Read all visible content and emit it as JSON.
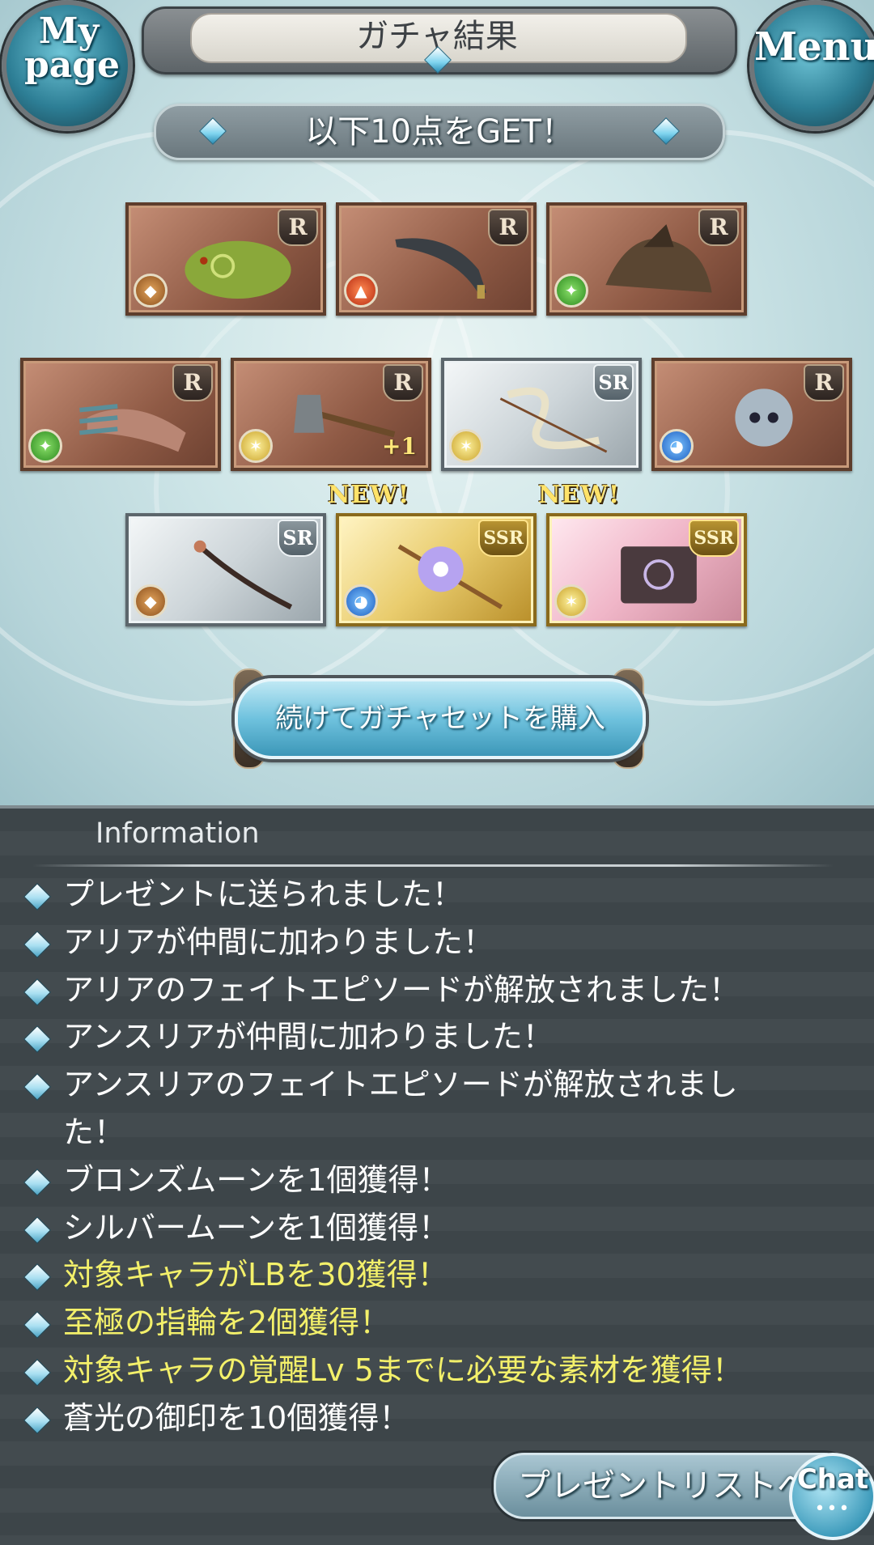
{
  "header": {
    "title": "ガチャ結果",
    "mypage_label_line1": "My",
    "mypage_label_line2": "page",
    "menu_label": "Menu"
  },
  "result_banner": "以下10点をGET！",
  "items": [
    {
      "rarity": "R",
      "element": "earth",
      "art": "green-frog-creature",
      "plus": "",
      "new": ""
    },
    {
      "rarity": "R",
      "element": "fire",
      "art": "scimitar",
      "plus": "",
      "new": ""
    },
    {
      "rarity": "R",
      "element": "wind",
      "art": "griffin-beast",
      "plus": "",
      "new": ""
    },
    {
      "rarity": "R",
      "element": "wind",
      "art": "claw-gauntlet",
      "plus": "",
      "new": ""
    },
    {
      "rarity": "R",
      "element": "light",
      "art": "battle-axe",
      "plus": "+1",
      "new": ""
    },
    {
      "rarity": "SR",
      "element": "light",
      "art": "ribbon-staff",
      "plus": "",
      "new": ""
    },
    {
      "rarity": "R",
      "element": "water",
      "art": "armored-skeleton",
      "plus": "",
      "new": ""
    },
    {
      "rarity": "SR",
      "element": "earth",
      "art": "long-bow",
      "plus": "",
      "new": ""
    },
    {
      "rarity": "SSR",
      "element": "water",
      "art": "flower-staff",
      "plus": "",
      "new": "NEW!"
    },
    {
      "rarity": "SSR",
      "element": "light",
      "art": "grimoire-book",
      "plus": "",
      "new": "NEW!"
    }
  ],
  "buy_button": "続けてガチャセットを購入",
  "information": {
    "title": "Information",
    "messages": [
      {
        "text": "プレゼントに送られました！",
        "highlight": false
      },
      {
        "text": "アリアが仲間に加わりました！",
        "highlight": false
      },
      {
        "text": "アリアのフェイトエピソードが解放されました！",
        "highlight": false
      },
      {
        "text": "アンスリアが仲間に加わりました！",
        "highlight": false
      },
      {
        "text": "アンスリアのフェイトエピソードが解放されまし",
        "highlight": false
      },
      {
        "text": "た！",
        "highlight": false
      },
      {
        "text": "ブロンズムーンを1個獲得！",
        "highlight": false
      },
      {
        "text": "シルバームーンを1個獲得！",
        "highlight": false
      },
      {
        "text": "対象キャラがLBを30獲得！",
        "highlight": true
      },
      {
        "text": "至極の指輪を2個獲得！",
        "highlight": true
      },
      {
        "text": "対象キャラの覚醒Lv 5までに必要な素材を獲得！",
        "highlight": true
      },
      {
        "text": "蒼光の御印を10個獲得！",
        "highlight": false
      }
    ]
  },
  "present_button": "プレゼントリストへ",
  "chat_button": "Chat",
  "chat_dots": "•••"
}
